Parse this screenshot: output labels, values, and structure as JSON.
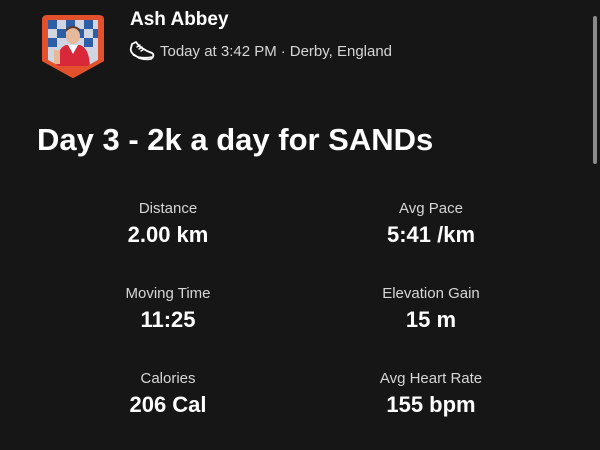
{
  "athlete": {
    "name": "Ash Abbey"
  },
  "activity": {
    "sport_icon": "running-shoe-icon",
    "time_label": "Today at 3:42 PM",
    "separator": "·",
    "location": "Derby, England",
    "title": "Day 3 - 2k a day for SANDs"
  },
  "stats": [
    {
      "label": "Distance",
      "value": "2.00 km"
    },
    {
      "label": "Avg Pace",
      "value": "5:41 /km"
    },
    {
      "label": "Moving Time",
      "value": "11:25"
    },
    {
      "label": "Elevation Gain",
      "value": "15 m"
    },
    {
      "label": "Calories",
      "value": "206 Cal"
    },
    {
      "label": "Avg Heart Rate",
      "value": "155 bpm"
    }
  ],
  "colors": {
    "background": "#161616",
    "avatar_badge": "#e2512b",
    "text_primary": "#ffffff",
    "text_secondary": "#d6d6d6"
  }
}
